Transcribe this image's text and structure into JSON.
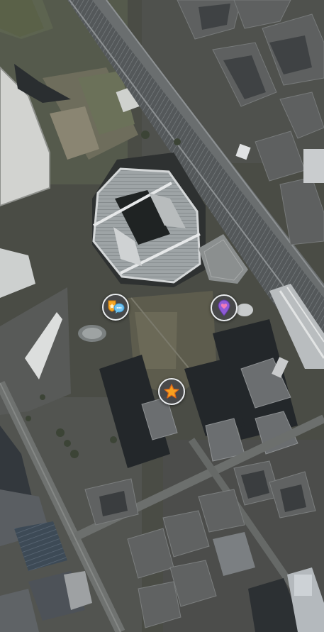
{
  "map": {
    "view": "satellite",
    "markers": [
      {
        "id": "chat-badge",
        "icon": "chat-badge-icon",
        "colors": {
          "badge": "#f5a623",
          "bubble": "#6fc3f0"
        }
      },
      {
        "id": "heart-pin",
        "icon": "heart-pin-icon",
        "colors": {
          "pin": "#8e5bd6",
          "heart": "#f07ab8"
        }
      },
      {
        "id": "favorite",
        "icon": "star-icon",
        "colors": {
          "star": "#f7a01f",
          "outline": "#d8641a"
        }
      }
    ]
  }
}
